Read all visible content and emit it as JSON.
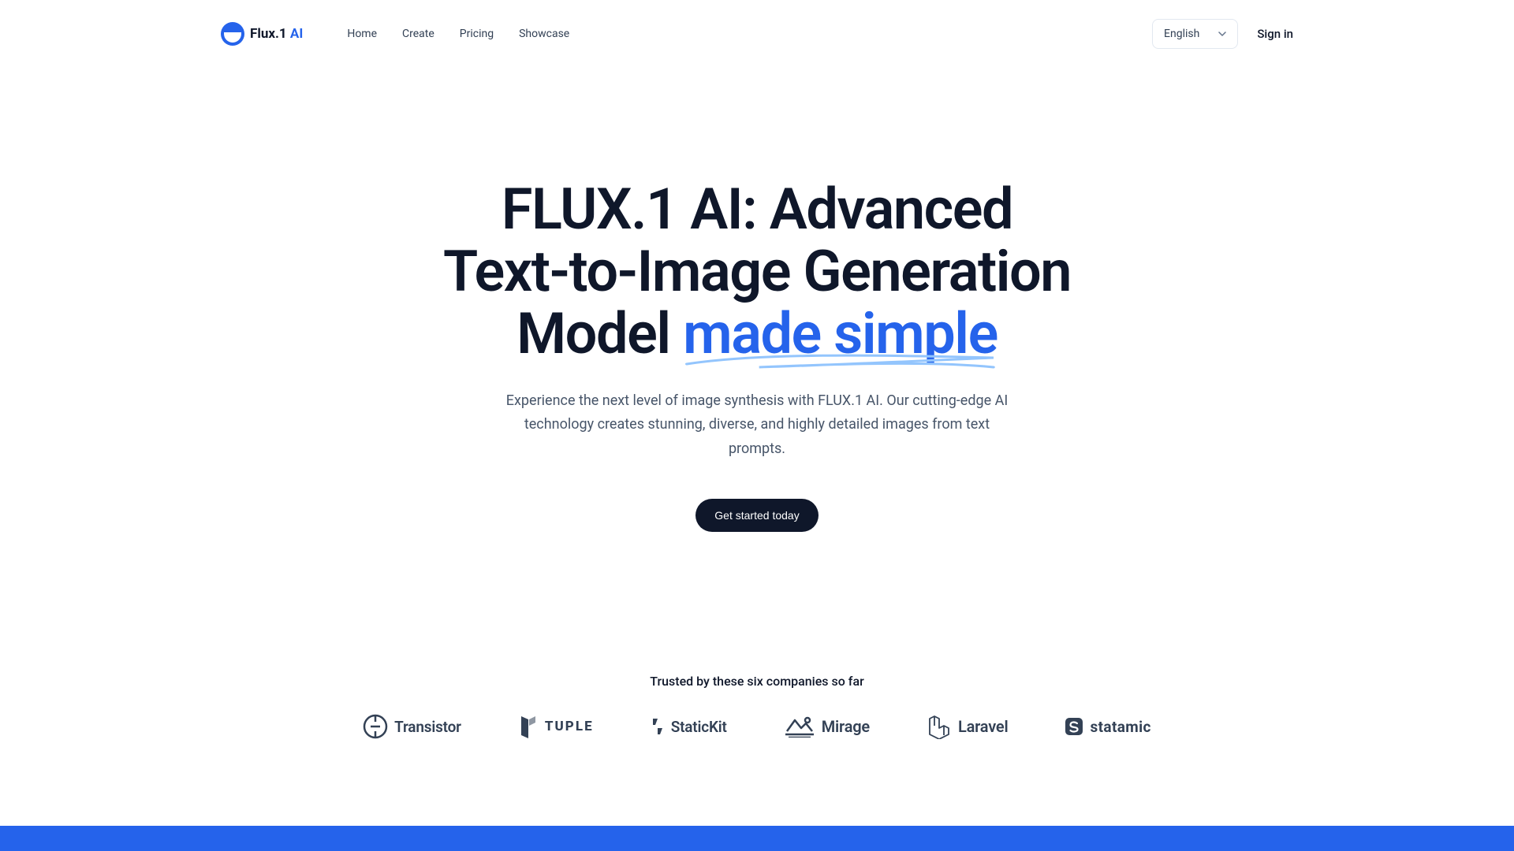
{
  "header": {
    "logo_text1": "Flux.1 ",
    "logo_text2": "AI",
    "nav": [
      {
        "label": "Home"
      },
      {
        "label": "Create"
      },
      {
        "label": "Pricing"
      },
      {
        "label": "Showcase"
      }
    ],
    "language": "English",
    "signin": "Sign in"
  },
  "hero": {
    "title_line1": "FLUX.1 AI: Advanced",
    "title_line2": "Text-to-Image Generation",
    "title_line3_plain": "Model ",
    "title_line3_highlight": "made simple",
    "subtitle": "Experience the next level of image synthesis with FLUX.1 AI. Our cutting-edge AI technology creates stunning, diverse, and highly detailed images from text prompts.",
    "cta": "Get started today"
  },
  "trusted": {
    "label": "Trusted by these six companies so far",
    "companies": [
      {
        "name": "Transistor"
      },
      {
        "name": "TUPLE"
      },
      {
        "name": "StaticKit"
      },
      {
        "name": "Mirage"
      },
      {
        "name": "Laravel"
      },
      {
        "name": "statamic"
      }
    ]
  },
  "colors": {
    "accent": "#2563eb",
    "dark": "#0f172a"
  }
}
